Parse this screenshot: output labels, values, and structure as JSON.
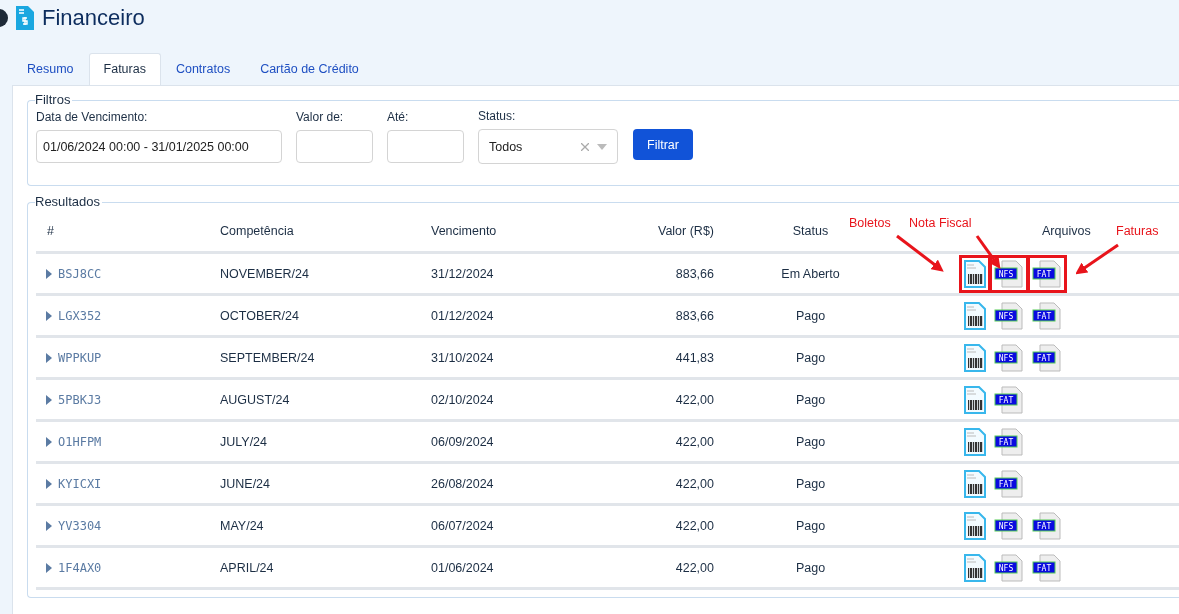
{
  "page": {
    "title": "Financeiro"
  },
  "tabs": [
    {
      "label": "Resumo",
      "selected": false
    },
    {
      "label": "Faturas",
      "selected": true
    },
    {
      "label": "Contratos",
      "selected": false
    },
    {
      "label": "Cartão de Crédito",
      "selected": false
    }
  ],
  "filters": {
    "legend": "Filtros",
    "date": {
      "label": "Data de Vencimento:",
      "value": "01/06/2024 00:00 - 31/01/2025 00:00"
    },
    "value_from": {
      "label": "Valor de:"
    },
    "value_to": {
      "label": "Até:"
    },
    "status": {
      "label": "Status:",
      "value": "Todos"
    },
    "button": "Filtrar"
  },
  "results": {
    "legend": "Resultados",
    "columns": [
      "#",
      "Competência",
      "Vencimento",
      "Valor (R$)",
      "Status",
      "Arquivos"
    ],
    "rows": [
      {
        "id": "BSJ8CC",
        "period": "NOVEMBER/24",
        "due": "31/12/2024",
        "value": "883,66",
        "status": "Em Aberto",
        "files": [
          {
            "kind": "boleto",
            "outlined": true
          },
          {
            "kind": "document",
            "label": "NFS",
            "outlined": true
          },
          {
            "kind": "document",
            "label": "FAT",
            "outlined": true
          }
        ]
      },
      {
        "id": "LGX352",
        "period": "OCTOBER/24",
        "due": "01/12/2024",
        "value": "883,66",
        "status": "Pago",
        "files": [
          {
            "kind": "boleto",
            "outlined": false
          },
          {
            "kind": "document",
            "label": "NFS",
            "outlined": false
          },
          {
            "kind": "document",
            "label": "FAT",
            "outlined": false
          }
        ]
      },
      {
        "id": "WPPKUP",
        "period": "SEPTEMBER/24",
        "due": "31/10/2024",
        "value": "441,83",
        "status": "Pago",
        "files": [
          {
            "kind": "boleto",
            "outlined": false
          },
          {
            "kind": "document",
            "label": "NFS",
            "outlined": false
          },
          {
            "kind": "document",
            "label": "FAT",
            "outlined": false
          }
        ]
      },
      {
        "id": "5PBKJ3",
        "period": "AUGUST/24",
        "due": "02/10/2024",
        "value": "422,00",
        "status": "Pago",
        "files": [
          {
            "kind": "boleto",
            "outlined": false
          },
          {
            "kind": "document",
            "label": "FAT",
            "outlined": false
          }
        ]
      },
      {
        "id": "O1HFPM",
        "period": "JULY/24",
        "due": "06/09/2024",
        "value": "422,00",
        "status": "Pago",
        "files": [
          {
            "kind": "boleto",
            "outlined": false
          },
          {
            "kind": "document",
            "label": "FAT",
            "outlined": false
          }
        ]
      },
      {
        "id": "KYICXI",
        "period": "JUNE/24",
        "due": "26/08/2024",
        "value": "422,00",
        "status": "Pago",
        "files": [
          {
            "kind": "boleto",
            "outlined": false
          },
          {
            "kind": "document",
            "label": "FAT",
            "outlined": false
          }
        ]
      },
      {
        "id": "YV3304",
        "period": "MAY/24",
        "due": "06/07/2024",
        "value": "422,00",
        "status": "Pago",
        "files": [
          {
            "kind": "boleto",
            "outlined": false
          },
          {
            "kind": "document",
            "label": "NFS",
            "outlined": false
          },
          {
            "kind": "document",
            "label": "FAT",
            "outlined": false
          }
        ]
      },
      {
        "id": "1F4AX0",
        "period": "APRIL/24",
        "due": "01/06/2024",
        "value": "422,00",
        "status": "Pago",
        "files": [
          {
            "kind": "boleto",
            "outlined": false
          },
          {
            "kind": "document",
            "label": "NFS",
            "outlined": false
          },
          {
            "kind": "document",
            "label": "FAT",
            "outlined": false
          }
        ]
      }
    ]
  },
  "annotations": [
    "Boletos",
    "Nota Fiscal",
    "Faturas"
  ]
}
